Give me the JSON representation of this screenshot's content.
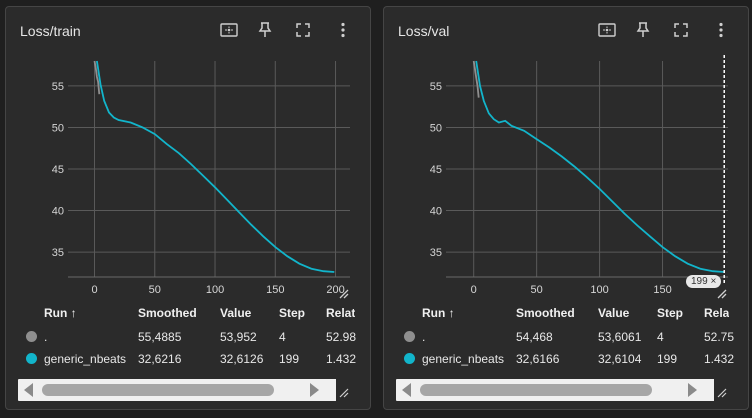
{
  "panels": [
    {
      "title": "Loss/train",
      "y_ticks": [
        "55",
        "50",
        "45",
        "40",
        "35"
      ],
      "x_ticks": [
        "0",
        "50",
        "100",
        "150",
        "200"
      ],
      "table": {
        "headers": {
          "run": "Run ↑",
          "smoothed": "Smoothed",
          "value": "Value",
          "step": "Step",
          "relative": "Relat"
        },
        "rows": [
          {
            "run": ".",
            "smoothed": "55,4885",
            "value": "53,952",
            "step": "4",
            "relative": "52.98",
            "color": "#8f8f8f"
          },
          {
            "run": "generic_nbeats",
            "smoothed": "32,6216",
            "value": "32,6126",
            "step": "199",
            "relative": "1.432",
            "color": "#12b5cb"
          }
        ]
      }
    },
    {
      "title": "Loss/val",
      "y_ticks": [
        "55",
        "50",
        "45",
        "40",
        "35"
      ],
      "x_ticks": [
        "0",
        "50",
        "100",
        "150"
      ],
      "cursor_step": "199",
      "table": {
        "headers": {
          "run": "Run ↑",
          "smoothed": "Smoothed",
          "value": "Value",
          "step": "Step",
          "relative": "Rela"
        },
        "rows": [
          {
            "run": ".",
            "smoothed": "54,468",
            "value": "53,6061",
            "step": "4",
            "relative": "52.75",
            "color": "#8f8f8f"
          },
          {
            "run": "generic_nbeats",
            "smoothed": "32,6166",
            "value": "32,6104",
            "step": "199",
            "relative": "1.432",
            "color": "#12b5cb"
          }
        ]
      }
    }
  ],
  "chart_data": [
    {
      "type": "line",
      "title": "Loss/train",
      "xlim": [
        -22,
        212
      ],
      "ylim": [
        32,
        58
      ],
      "grid": true,
      "series": [
        {
          "name": ".",
          "color": "#8f8f8f",
          "x": [
            0,
            1,
            2,
            3,
            4
          ],
          "y": [
            58,
            57.2,
            56.1,
            55.5,
            54.0
          ]
        },
        {
          "name": "generic_nbeats",
          "color": "#12b5cb",
          "x": [
            2,
            5,
            8,
            12,
            16,
            20,
            30,
            40,
            50,
            60,
            70,
            80,
            90,
            100,
            110,
            120,
            130,
            140,
            150,
            160,
            170,
            180,
            190,
            199
          ],
          "y": [
            58,
            55.2,
            53.2,
            51.8,
            51.2,
            50.9,
            50.6,
            50.0,
            49.2,
            48.0,
            46.9,
            45.6,
            44.2,
            42.8,
            41.3,
            39.8,
            38.3,
            36.9,
            35.6,
            34.5,
            33.6,
            33.0,
            32.7,
            32.6
          ]
        }
      ]
    },
    {
      "type": "line",
      "title": "Loss/val",
      "xlim": [
        -22,
        202
      ],
      "ylim": [
        32,
        58
      ],
      "grid": true,
      "series": [
        {
          "name": ".",
          "color": "#8f8f8f",
          "x": [
            0,
            1,
            2,
            3,
            4
          ],
          "y": [
            58,
            57.0,
            56.0,
            55.0,
            53.6
          ]
        },
        {
          "name": "generic_nbeats",
          "color": "#12b5cb",
          "x": [
            2,
            5,
            8,
            12,
            16,
            20,
            25,
            30,
            40,
            50,
            60,
            70,
            80,
            90,
            100,
            110,
            120,
            130,
            140,
            150,
            160,
            170,
            180,
            190,
            199
          ],
          "y": [
            58,
            55.0,
            53.2,
            51.7,
            51.0,
            50.6,
            50.8,
            50.2,
            49.6,
            48.6,
            47.6,
            46.5,
            45.3,
            44.0,
            42.6,
            41.1,
            39.6,
            38.2,
            36.9,
            35.6,
            34.5,
            33.6,
            33.0,
            32.7,
            32.6
          ]
        }
      ]
    }
  ]
}
